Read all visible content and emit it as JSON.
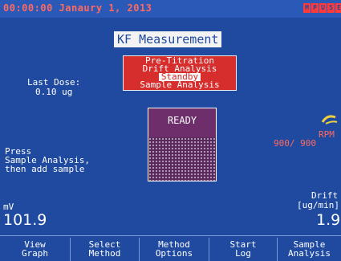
{
  "header": {
    "datetime": "00:00:00 Janaury 1, 2013",
    "status_badges": [
      "M",
      "P",
      "U",
      "S",
      "E"
    ]
  },
  "title": "KF Measurement",
  "menu": {
    "items": [
      "Pre-Titration",
      "Drift Analysis",
      "Standby",
      "Sample Analysis"
    ],
    "selected": "Standby"
  },
  "last_dose": {
    "label": "Last Dose:",
    "value": "0.10 ug"
  },
  "instruction": "Press\nSample Analysis,\nthen add sample",
  "beaker": {
    "status": "READY"
  },
  "stirrer": {
    "label": "RPM",
    "value": "900/ 900"
  },
  "readings": {
    "mv_label": "mV",
    "mv_value": "101.9",
    "drift_label": "Drift",
    "drift_unit": "[ug/min]",
    "drift_value": "1.9"
  },
  "softkeys": [
    "View\nGraph",
    "Select\nMethod",
    "Method\nOptions",
    "Start\nLog",
    "Sample\nAnalysis"
  ]
}
